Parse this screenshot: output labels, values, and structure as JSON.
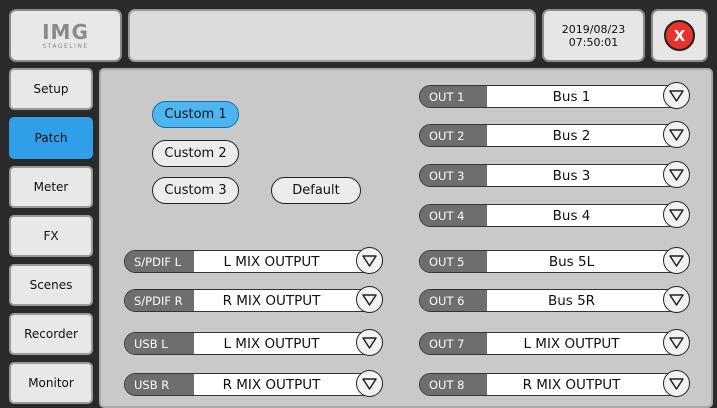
{
  "header": {
    "logo": {
      "main": "IMG",
      "sub": "STAGELINE"
    },
    "datetime": {
      "date": "2019/08/23",
      "time": "07:50:01"
    },
    "close_label": "X"
  },
  "sidebar": {
    "items": [
      {
        "label": "Setup"
      },
      {
        "label": "Patch"
      },
      {
        "label": "Meter"
      },
      {
        "label": "FX"
      },
      {
        "label": "Scenes"
      },
      {
        "label": "Recorder"
      },
      {
        "label": "Monitor"
      }
    ],
    "active": "Patch"
  },
  "presets": {
    "items": [
      "Custom 1",
      "Custom 2",
      "Custom 3"
    ],
    "selected": "Custom 1",
    "default_label": "Default"
  },
  "digital_outputs": [
    {
      "tag": "S/PDIF L",
      "value": "L MIX OUTPUT"
    },
    {
      "tag": "S/PDIF R",
      "value": "R MIX OUTPUT"
    },
    {
      "tag": "USB L",
      "value": "L MIX OUTPUT"
    },
    {
      "tag": "USB R",
      "value": "R MIX OUTPUT"
    }
  ],
  "outputs": [
    {
      "tag": "OUT 1",
      "value": "Bus 1"
    },
    {
      "tag": "OUT 2",
      "value": "Bus 2"
    },
    {
      "tag": "OUT 3",
      "value": "Bus 3"
    },
    {
      "tag": "OUT 4",
      "value": "Bus 4"
    },
    {
      "tag": "OUT 5",
      "value": "Bus 5L"
    },
    {
      "tag": "OUT 6",
      "value": "Bus 5R"
    },
    {
      "tag": "OUT 7",
      "value": "L MIX OUTPUT"
    },
    {
      "tag": "OUT 8",
      "value": "R MIX OUTPUT"
    }
  ],
  "colors": {
    "accent": "#2f9fe9",
    "selected_preset": "#4cb6f3",
    "close": "#e8322b",
    "panel": "#c9c9c9",
    "tag": "#6e6e6e"
  },
  "icons": {
    "dropdown": "triangle-down-icon",
    "close": "close-icon"
  }
}
